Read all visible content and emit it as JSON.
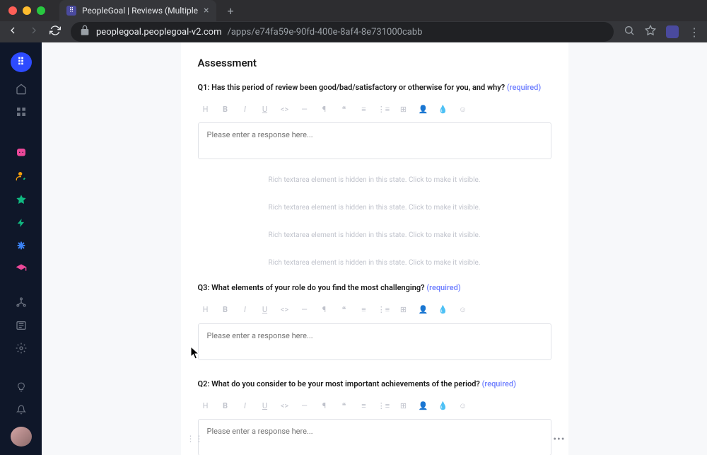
{
  "browser": {
    "tab_title": "PeopleGoal | Reviews (Multiple",
    "url_host": "peoplegoal.peoplegoal-v2.com",
    "url_path": "/apps/e74fa59e-90fd-400e-8af4-8e731000cabb"
  },
  "page": {
    "heading": "Assessment",
    "placeholder": "Please enter a response here...",
    "hidden_message": "Rich textarea element is hidden in this state. Click to make it visible.",
    "required_label": "(required)",
    "questions": {
      "q1": {
        "label": "Q1: Has this period of review been good/bad/satisfactory or otherwise for you, and why?"
      },
      "q3": {
        "label": "Q3: What elements of your role do you find the most challenging?"
      },
      "q2": {
        "label": "Q2: What do you consider to be your most important achievements of the period?"
      }
    },
    "toolbar_icons": [
      "H",
      "B",
      "I",
      "U",
      "<>",
      "—",
      "¶",
      "”",
      "≡",
      "⋮≡",
      "⊞",
      "👤",
      "💧",
      "☺"
    ]
  },
  "sidebar": {
    "items": [
      "home",
      "grid",
      "robot",
      "user-edit",
      "star",
      "bolt",
      "asterisk",
      "grad-cap",
      "org",
      "list",
      "gear",
      "bulb",
      "bell"
    ]
  }
}
